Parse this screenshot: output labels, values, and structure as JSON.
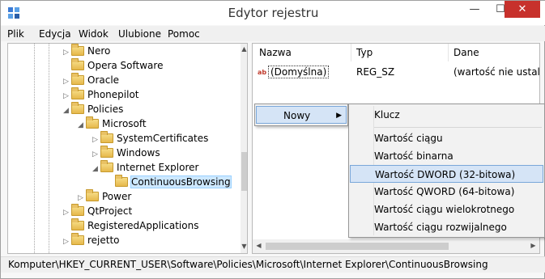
{
  "window": {
    "title": "Edytor rejestru",
    "minimize": "—",
    "maximize": "☐",
    "close": "✕"
  },
  "menu": [
    "Plik",
    "Edycja",
    "Widok",
    "Ulubione",
    "Pomoc"
  ],
  "tree": {
    "items": [
      {
        "label": "Nero"
      },
      {
        "label": "Opera Software"
      },
      {
        "label": "Oracle"
      },
      {
        "label": "Phonepilot"
      },
      {
        "label": "Policies"
      },
      {
        "label": "Microsoft"
      },
      {
        "label": "SystemCertificates"
      },
      {
        "label": "Windows"
      },
      {
        "label": "Internet Explorer"
      },
      {
        "label": "ContinuousBrowsing"
      },
      {
        "label": "Power"
      },
      {
        "label": "QtProject"
      },
      {
        "label": "RegisteredApplications"
      },
      {
        "label": "rejetto"
      }
    ]
  },
  "list": {
    "columns": [
      "Nazwa",
      "Typ",
      "Dane"
    ],
    "rows": [
      {
        "name": "(Domyślna)",
        "type": "REG_SZ",
        "data": "(wartość nie ustalona)"
      }
    ]
  },
  "context_menu": {
    "new_label": "Nowy",
    "submenu": [
      "Klucz",
      "Wartość ciągu",
      "Wartość binarna",
      "Wartość DWORD (32-bitowa)",
      "Wartość QWORD (64-bitowa)",
      "Wartość ciągu wielokrotnego",
      "Wartość ciągu rozwijalnego"
    ],
    "highlighted": "Wartość DWORD (32-bitowa)"
  },
  "status": {
    "path": "Komputer\\HKEY_CURRENT_USER\\Software\\Policies\\Microsoft\\Internet Explorer\\ContinuousBrowsing"
  },
  "icons": {
    "app": "registry-editor-icon",
    "folder": "folder-icon",
    "string_value": "string-value-icon"
  },
  "colors": {
    "close_button": "#c7312c",
    "selection": "#cde8ff",
    "menu_highlight": "#d5e4f6"
  }
}
